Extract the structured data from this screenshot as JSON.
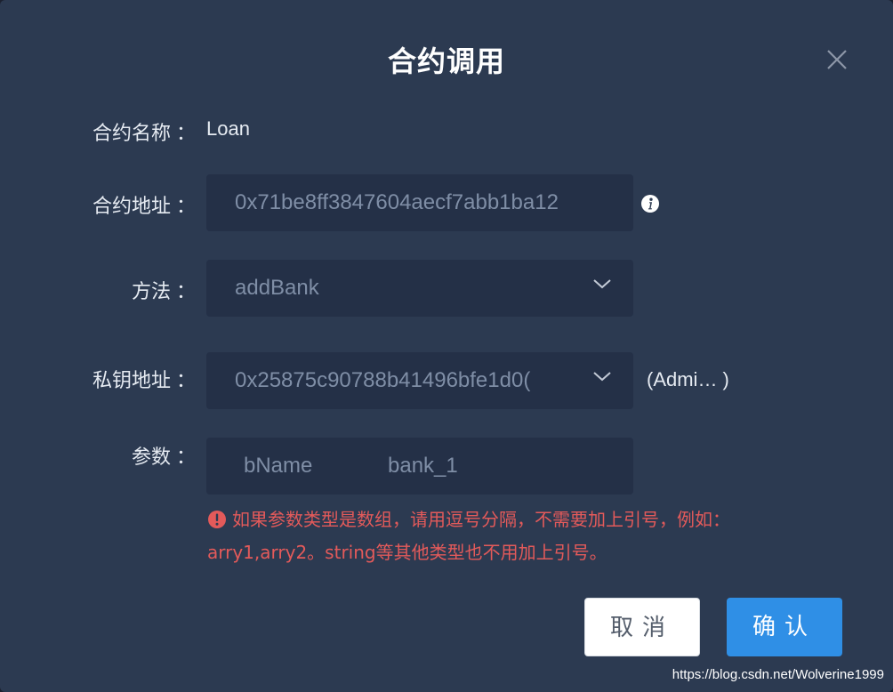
{
  "dialog": {
    "title": "合约调用",
    "close_icon": "close-icon"
  },
  "form": {
    "contract_name": {
      "label": "合约名称",
      "colon": "：",
      "value": "Loan"
    },
    "contract_address": {
      "label": "合约地址",
      "colon": "：",
      "value": "0x71be8ff3847604aecf7abb1ba12",
      "icon": "info-icon"
    },
    "method": {
      "label": "方法",
      "colon": "：",
      "value": "addBank",
      "icon": "chevron-down-icon"
    },
    "private_key_address": {
      "label": "私钥地址",
      "colon": "：",
      "value": "0x25875c90788b41496bfe1d0(",
      "icon": "chevron-down-icon",
      "role": "(Admi… )"
    },
    "params": {
      "label": "参数",
      "colon": "：",
      "name": "bName",
      "value": "bank_1"
    },
    "warning": {
      "icon": "warning-icon",
      "line1": "如果参数类型是数组，请用逗号分隔，不需要加上引号，例如：",
      "line2": "arry1,arry2。string等其他类型也不用加上引号。"
    }
  },
  "footer": {
    "cancel_label": "取消",
    "ok_label": "确认"
  },
  "watermark": "https://blog.csdn.net/Wolverine1999",
  "colors": {
    "dialog_bg": "#2c3a51",
    "field_bg": "#243047",
    "primary": "#2f8fe6",
    "error": "#e35a5a"
  }
}
